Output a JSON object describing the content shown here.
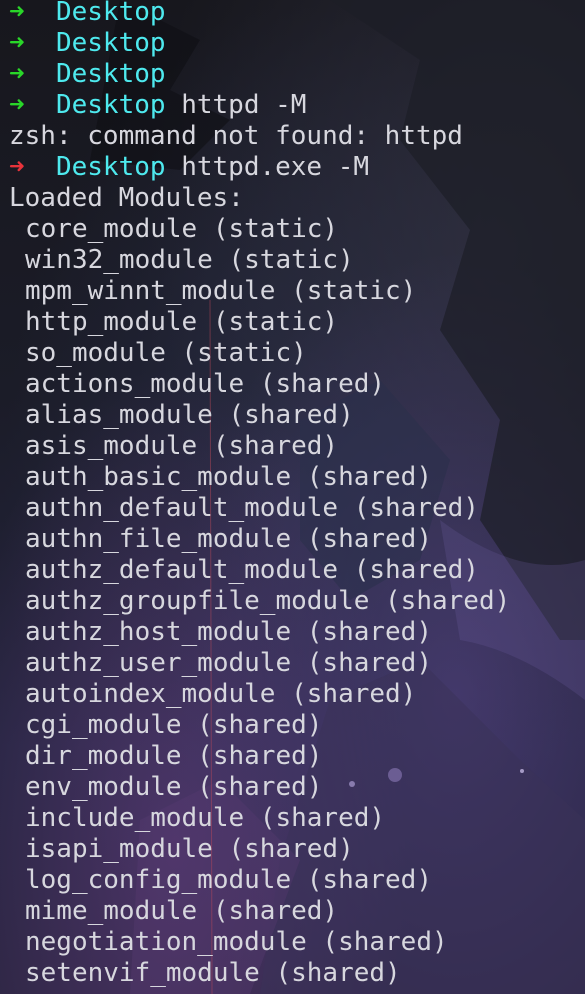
{
  "prompt": {
    "arrow": "➜",
    "directory": "Desktop"
  },
  "colors": {
    "arrow_success": "#29d629",
    "arrow_error": "#e8333b",
    "directory": "#4ee9ee",
    "text": "#d7d7de"
  },
  "history": [
    {
      "status": "ok",
      "command": ""
    },
    {
      "status": "ok",
      "command": ""
    },
    {
      "status": "ok",
      "command": ""
    },
    {
      "status": "ok",
      "command": "httpd -M"
    }
  ],
  "error_output": "zsh: command not found: httpd",
  "last_command": {
    "status": "error",
    "command": "httpd.exe -M"
  },
  "output_header": "Loaded Modules:",
  "modules": [
    "core_module (static)",
    "win32_module (static)",
    "mpm_winnt_module (static)",
    "http_module (static)",
    "so_module (static)",
    "actions_module (shared)",
    "alias_module (shared)",
    "asis_module (shared)",
    "auth_basic_module (shared)",
    "authn_default_module (shared)",
    "authn_file_module (shared)",
    "authz_default_module (shared)",
    "authz_groupfile_module (shared)",
    "authz_host_module (shared)",
    "authz_user_module (shared)",
    "autoindex_module (shared)",
    "cgi_module (shared)",
    "dir_module (shared)",
    "env_module (shared)",
    "include_module (shared)",
    "isapi_module (shared)",
    "log_config_module (shared)",
    "mime_module (shared)",
    "negotiation_module (shared)",
    "setenvif_module (shared)"
  ]
}
